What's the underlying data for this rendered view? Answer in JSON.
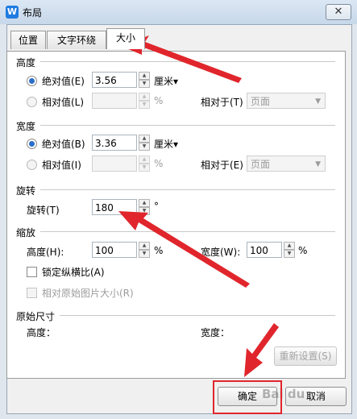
{
  "window": {
    "title": "布局",
    "app_icon_letter": "W",
    "close_glyph": "✕"
  },
  "tabs": [
    {
      "label": "位置"
    },
    {
      "label": "文字环绕"
    },
    {
      "label": "大小",
      "active": true
    }
  ],
  "height_section": {
    "title": "高度",
    "absolute": {
      "label": "绝对值(E)",
      "value": "3.56",
      "unit": "厘米▾",
      "checked": true
    },
    "relative": {
      "label": "相对值(L)",
      "value": "",
      "unit": "%",
      "relative_to_label": "相对于(T)",
      "relative_to_value": "页面"
    }
  },
  "width_section": {
    "title": "宽度",
    "absolute": {
      "label": "绝对值(B)",
      "value": "3.36",
      "unit": "厘米▾",
      "checked": true
    },
    "relative": {
      "label": "相对值(I)",
      "value": "",
      "unit": "%",
      "relative_to_label": "相对于(E)",
      "relative_to_value": "页面"
    }
  },
  "rotation_section": {
    "title": "旋转",
    "label": "旋转(T)",
    "value": "180",
    "unit": "°"
  },
  "scale_section": {
    "title": "缩放",
    "height_label": "高度(H):",
    "height_value": "100",
    "height_unit": "%",
    "width_label": "宽度(W):",
    "width_value": "100",
    "width_unit": "%",
    "lock_ratio_label": "锁定纵横比(A)",
    "relative_original_label": "相对原始图片大小(R)"
  },
  "original_size_section": {
    "title": "原始尺寸",
    "height_label": "高度：",
    "width_label": "宽度：",
    "reset_label": "重新设置(S)"
  },
  "buttons": {
    "ok": "确定",
    "cancel": "取消"
  },
  "watermark_text": "Bai du",
  "colors": {
    "annotation_red": "#e0262c",
    "radio_accent": "#2b6ec9"
  }
}
